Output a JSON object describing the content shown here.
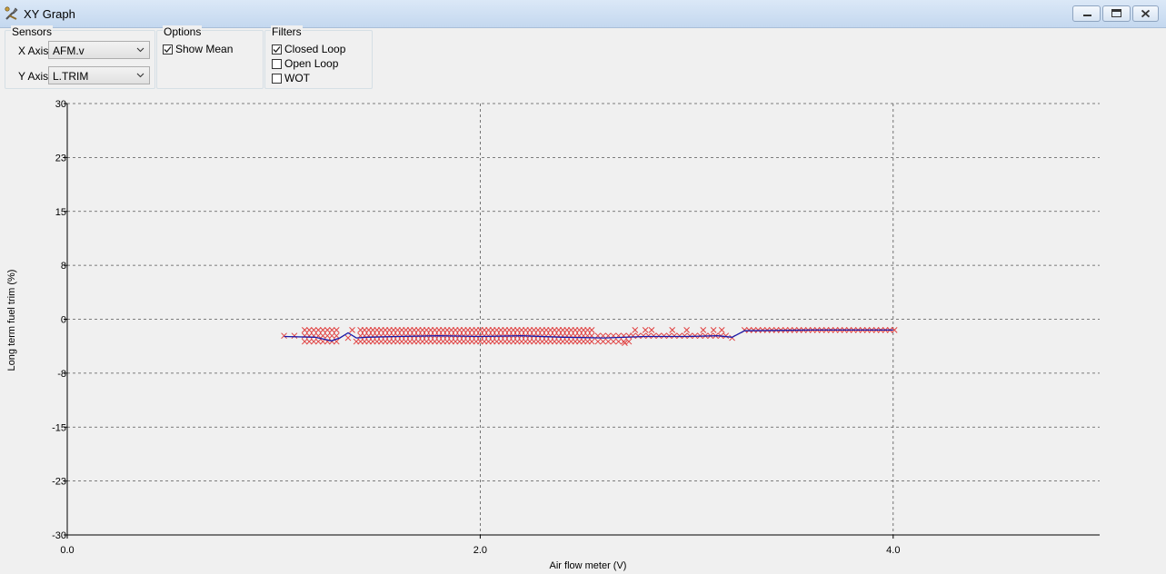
{
  "window": {
    "title": "XY Graph",
    "app_icon": "wrench-tools-icon"
  },
  "controls": {
    "sensors": {
      "label": "Sensors",
      "x_axis": {
        "label": "X Axis",
        "value": "AFM.v"
      },
      "y_axis": {
        "label": "Y Axis",
        "value": "L.TRIM"
      }
    },
    "options": {
      "label": "Options",
      "show_mean": {
        "label": "Show Mean",
        "checked": true
      }
    },
    "filters": {
      "label": "Filters",
      "closed_loop": {
        "label": "Closed Loop",
        "checked": true
      },
      "open_loop": {
        "label": "Open Loop",
        "checked": false
      },
      "wot": {
        "label": "WOT",
        "checked": false
      }
    }
  },
  "chart_data": {
    "type": "scatter",
    "xlabel": "Air flow meter (V)",
    "ylabel": "Long term fuel trim (%)",
    "xlim": [
      0,
      5
    ],
    "ylim": [
      -30,
      30
    ],
    "x_ticks": [
      {
        "value": 0,
        "label": "0.0"
      },
      {
        "value": 2,
        "label": "2.0"
      },
      {
        "value": 4,
        "label": "4.0"
      }
    ],
    "y_ticks": [
      {
        "value": 30,
        "label": "30"
      },
      {
        "value": 22.5,
        "label": "23"
      },
      {
        "value": 15,
        "label": "15"
      },
      {
        "value": 7.5,
        "label": "8"
      },
      {
        "value": 0,
        "label": "0"
      },
      {
        "value": -7.5,
        "label": "-8"
      },
      {
        "value": -15,
        "label": "-15"
      },
      {
        "value": -22.5,
        "label": "-23"
      },
      {
        "value": -30,
        "label": "-30"
      }
    ],
    "grid": true,
    "scatter_color": "#e04040",
    "mean_color": "#1a1aa8",
    "series": [
      {
        "kind": "scatter",
        "bands": [
          {
            "x_start": 1.15,
            "x_end": 1.32,
            "x_step": 0.022,
            "y_values": [
              -1.5,
              -2.3,
              -3.1
            ]
          },
          {
            "x_start": 1.42,
            "x_end": 2.55,
            "x_step": 0.02,
            "y_values": [
              -1.5,
              -2.3,
              -3.1
            ]
          },
          {
            "x_start": 2.57,
            "x_end": 2.72,
            "x_step": 0.025,
            "y_values": [
              -2.3,
              -3.1
            ]
          },
          {
            "x_start": 2.74,
            "x_end": 3.2,
            "x_step": 0.025,
            "y_values": [
              -2.3
            ]
          },
          {
            "x_start": 3.28,
            "x_end": 4.02,
            "x_step": 0.022,
            "y_values": [
              -1.5
            ]
          }
        ],
        "extra_points": [
          {
            "x": 1.36,
            "y": -2.6
          },
          {
            "x": 1.38,
            "y": -1.5
          },
          {
            "x": 1.4,
            "y": -3.1
          },
          {
            "x": 1.05,
            "y": -2.3
          },
          {
            "x": 1.1,
            "y": -2.3
          },
          {
            "x": 2.75,
            "y": -1.5
          },
          {
            "x": 2.8,
            "y": -1.5
          },
          {
            "x": 2.83,
            "y": -1.5
          },
          {
            "x": 2.93,
            "y": -1.5
          },
          {
            "x": 3.0,
            "y": -1.5
          },
          {
            "x": 3.08,
            "y": -1.5
          },
          {
            "x": 3.13,
            "y": -1.5
          },
          {
            "x": 3.17,
            "y": -1.5
          },
          {
            "x": 3.22,
            "y": -2.6
          },
          {
            "x": 2.7,
            "y": -3.3
          }
        ]
      },
      {
        "kind": "line",
        "x": [
          1.05,
          1.2,
          1.28,
          1.32,
          1.36,
          1.4,
          1.45,
          1.6,
          1.8,
          2.0,
          2.2,
          2.4,
          2.6,
          2.8,
          3.0,
          3.15,
          3.22,
          3.28,
          3.6,
          4.0
        ],
        "y": [
          -2.4,
          -2.5,
          -3.0,
          -2.6,
          -1.9,
          -2.6,
          -2.5,
          -2.4,
          -2.3,
          -2.4,
          -2.3,
          -2.5,
          -2.6,
          -2.4,
          -2.4,
          -2.3,
          -2.5,
          -1.6,
          -1.5,
          -1.5
        ]
      }
    ]
  }
}
